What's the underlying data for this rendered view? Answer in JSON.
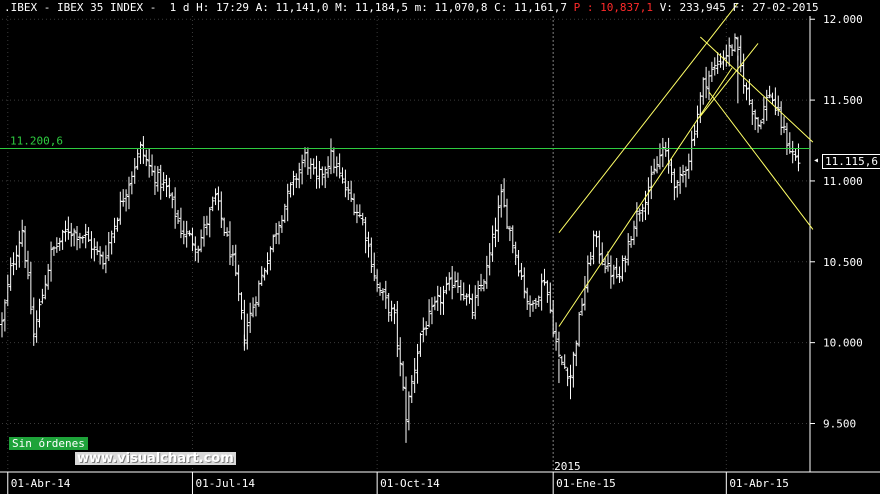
{
  "header": {
    "symbol": ".IBEX - IBEX 35 INDEX -",
    "period": "1 d",
    "info_before_p": "H: 17:29 A: 11,141,0 M: 11,184,5 m: 11,070,8 C: 11,161,7",
    "p_label": "P : 10,837,1",
    "info_after_p": "V: 233,945 F: 27-02-2015"
  },
  "badge_label": "Sin órdenes",
  "watermark": "www.visualchart.com",
  "last_value_label": "11.115,6",
  "hline_label": "11.200,6",
  "colors": {
    "background": "#000000",
    "bars": "#ffffff",
    "hline": "#2ecc40",
    "channel": "#ffff66",
    "grid": "#3a3a3a"
  },
  "chart_data": {
    "type": "ohlc",
    "xlim": [
      0,
      280
    ],
    "ylim": [
      9200,
      12020
    ],
    "x_ticks": [
      {
        "index": 2,
        "label": "01-Abr-14"
      },
      {
        "index": 66,
        "label": "01-Jul-14"
      },
      {
        "index": 130,
        "label": "01-Oct-14"
      },
      {
        "index": 191,
        "label": "01-Ene-15"
      },
      {
        "index": 251,
        "label": "01-Abr-15"
      }
    ],
    "year_marker": {
      "index": 191,
      "label": "2015"
    },
    "y_ticks": [
      {
        "value": 12000,
        "label": "12.000"
      },
      {
        "value": 11500,
        "label": "11.500"
      },
      {
        "value": 11000,
        "label": "11.000"
      },
      {
        "value": 10500,
        "label": "10.500"
      },
      {
        "value": 10000,
        "label": "10.000"
      },
      {
        "value": 9500,
        "label": "9.500"
      }
    ],
    "hline": {
      "value": 11200.6
    },
    "last_value": 11115.6,
    "anchors": [
      [
        0,
        10120
      ],
      [
        3,
        10450
      ],
      [
        7,
        10700
      ],
      [
        11,
        10050
      ],
      [
        17,
        10550
      ],
      [
        23,
        10700
      ],
      [
        29,
        10650
      ],
      [
        35,
        10500
      ],
      [
        41,
        10850
      ],
      [
        48,
        11200
      ],
      [
        52,
        11050
      ],
      [
        57,
        10950
      ],
      [
        62,
        10700
      ],
      [
        68,
        10600
      ],
      [
        74,
        10900
      ],
      [
        80,
        10500
      ],
      [
        84,
        10050
      ],
      [
        89,
        10350
      ],
      [
        95,
        10700
      ],
      [
        100,
        10950
      ],
      [
        105,
        11150
      ],
      [
        109,
        11000
      ],
      [
        114,
        11150
      ],
      [
        119,
        10950
      ],
      [
        125,
        10750
      ],
      [
        130,
        10350
      ],
      [
        136,
        10150
      ],
      [
        140,
        9550
      ],
      [
        145,
        10050
      ],
      [
        151,
        10250
      ],
      [
        157,
        10400
      ],
      [
        163,
        10200
      ],
      [
        168,
        10450
      ],
      [
        173,
        10900
      ],
      [
        178,
        10550
      ],
      [
        183,
        10200
      ],
      [
        188,
        10400
      ],
      [
        193,
        9900
      ],
      [
        197,
        9800
      ],
      [
        201,
        10250
      ],
      [
        205,
        10650
      ],
      [
        210,
        10450
      ],
      [
        214,
        10400
      ],
      [
        219,
        10750
      ],
      [
        224,
        10950
      ],
      [
        229,
        11200
      ],
      [
        234,
        10950
      ],
      [
        238,
        11150
      ],
      [
        243,
        11600
      ],
      [
        249,
        11750
      ],
      [
        254,
        11850
      ],
      [
        258,
        11550
      ],
      [
        262,
        11350
      ],
      [
        266,
        11550
      ],
      [
        270,
        11350
      ],
      [
        273,
        11200
      ],
      [
        276,
        11115
      ]
    ],
    "lines": [
      {
        "name": "channel-lower-1",
        "from": [
          193,
          10100
        ],
        "to": [
          253,
          11700
        ]
      },
      {
        "name": "channel-upper-1",
        "from": [
          193,
          10680
        ],
        "to": [
          255,
          12100
        ]
      },
      {
        "name": "channel-lower-2",
        "from": [
          245,
          11550
        ],
        "to": [
          281,
          10700
        ]
      },
      {
        "name": "channel-upper-2",
        "from": [
          242,
          11890
        ],
        "to": [
          281,
          11240
        ]
      },
      {
        "name": "cross-line",
        "from": [
          242,
          11400
        ],
        "to": [
          262,
          11850
        ]
      }
    ]
  }
}
